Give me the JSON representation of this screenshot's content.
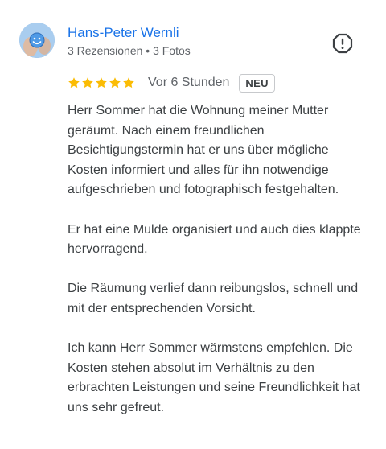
{
  "review": {
    "author": {
      "name": "Hans-Peter Wernli",
      "meta": "3 Rezensionen • 3 Fotos",
      "avatar_icon": "smiley-globe-avatar"
    },
    "rating": {
      "stars": 5,
      "max": 5,
      "star_color": "#fbbc04"
    },
    "time_ago": "Vor 6 Stunden",
    "badge": "NEU",
    "report_icon": "report-icon",
    "paragraphs": [
      "Herr Sommer hat die Wohnung meiner Mutter geräumt. Nach einem freundlichen Besichtigungstermin hat er uns über mögliche Kosten informiert und alles für ihn notwendige aufgeschrieben und fotographisch festgehalten.",
      "Er hat eine Mulde organisiert und auch dies klappte hervorragend.",
      "Die Räumung verlief dann reibungslos, schnell und mit der entsprechenden Vorsicht.",
      "Ich kann Herr Sommer wärmstens empfehlen. Die Kosten stehen absolut im Verhältnis zu den erbrachten Leistungen und seine Freundlichkeit hat uns sehr gefreut."
    ]
  },
  "colors": {
    "author_link": "#1a73e8",
    "secondary_text": "#5f6368",
    "body_text": "#3c4043"
  }
}
